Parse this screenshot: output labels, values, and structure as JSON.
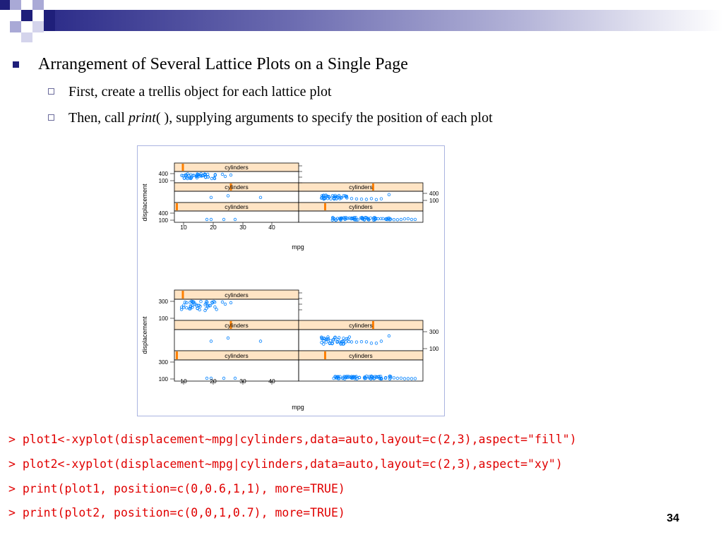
{
  "slide": {
    "bullet_main": "Arrangement of Several Lattice Plots on a Single Page",
    "sub_first": "First, create a trellis object for each lattice plot",
    "sub_then_pre": "Then, call ",
    "sub_then_italic": "print",
    "sub_then_post": "( ), supplying arguments to specify the position of each plot",
    "page_number": "34"
  },
  "colors": {
    "accent_navy": "#1f1f7a",
    "code_red": "#e00000",
    "strip_fill": "#ffe4c4",
    "point_blue": "#0080ff",
    "strip_marker": "#ff8000"
  },
  "code_lines": [
    "> plot1<-xyplot(displacement~mpg|cylinders,data=auto,layout=c(2,3),aspect=\"fill\")",
    "> plot2<-xyplot(displacement~mpg|cylinders,data=auto,layout=c(2,3),aspect=\"xy\")",
    "> print(plot1, position=c(0,0.6,1,1), more=TRUE)",
    "> print(plot2, position=c(0,0,1,0.7), more=TRUE)"
  ],
  "plots": [
    {
      "strip_label": "cylinders",
      "xlabel": "mpg",
      "ylabel": "displacement",
      "x_ticks": [
        "10",
        "20",
        "30",
        "40"
      ],
      "y_ticks": [
        "400",
        "100"
      ]
    },
    {
      "strip_label": "cylinders",
      "xlabel": "mpg",
      "ylabel": "displacement",
      "x_ticks": [
        "10",
        "20",
        "30",
        "40"
      ],
      "y_ticks": [
        "300",
        "100"
      ]
    }
  ]
}
